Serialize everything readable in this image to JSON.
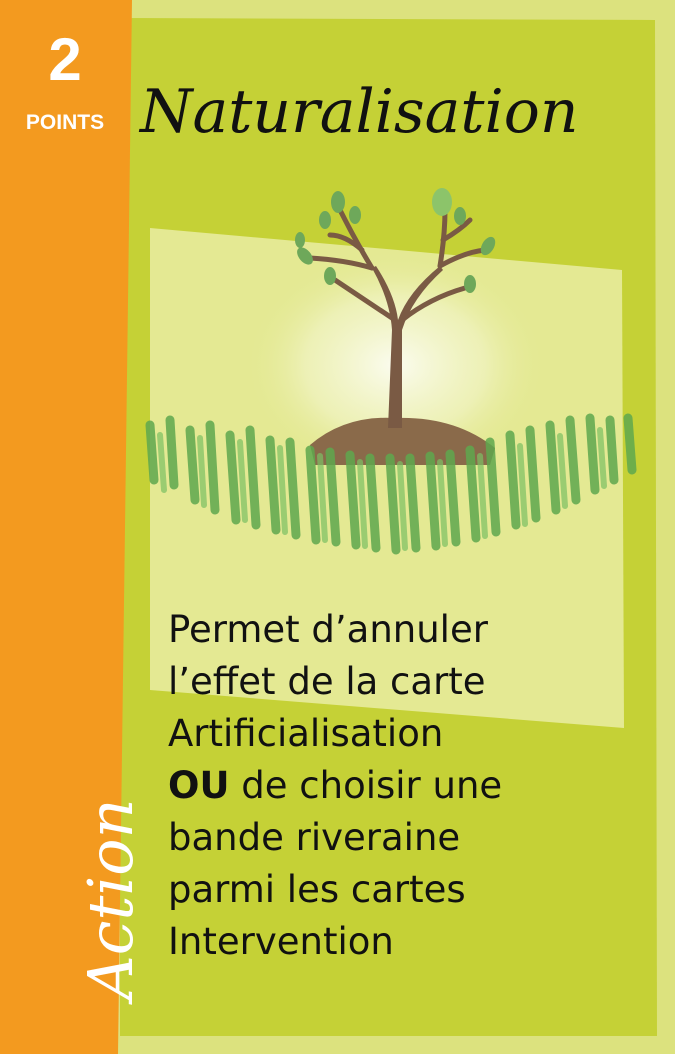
{
  "card": {
    "points_value": "2",
    "points_label": "POINTS",
    "title": "Naturalisation",
    "category": "Action",
    "rules": {
      "line1": "Permet d’annuler",
      "line2": "l’effet de la carte",
      "line3": "Artificialisation",
      "line4_bold": "OU",
      "line4_rest": " de choisir une",
      "line5": "bande riveraine",
      "line6": "parmi les cartes",
      "line7": "Intervention"
    },
    "illustration": "tree-with-grass",
    "colors": {
      "orange_band": "#f39a1f",
      "lime_panel": "#c7d33a",
      "pale_panel": "#e6eb9a",
      "text": "#111111"
    }
  }
}
